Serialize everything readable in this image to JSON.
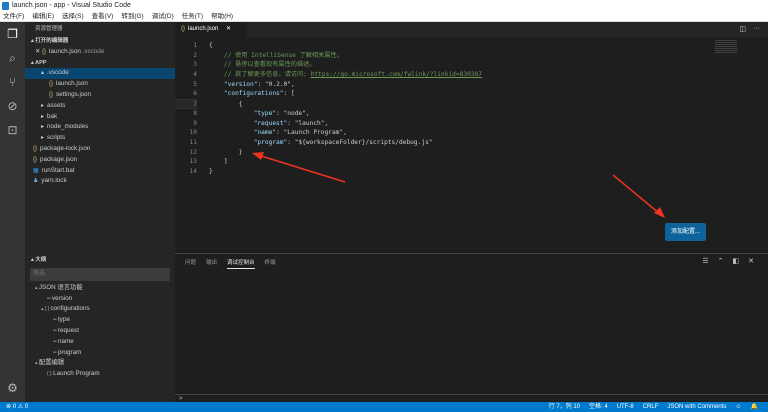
{
  "window": {
    "title": "launch.json - app - Visual Studio Code"
  },
  "menu": [
    "文件(F)",
    "编辑(E)",
    "选择(S)",
    "查看(V)",
    "转到(G)",
    "调试(D)",
    "任务(T)",
    "帮助(H)"
  ],
  "sidebar": {
    "title": "资源管理器",
    "open_editors_label": "打开的编辑器",
    "open_file": "launch.json",
    "open_file_dir": ".vscode",
    "project_label": "APP",
    "tree": [
      {
        "label": ".vscode",
        "kind": "folder-open",
        "depth": 1,
        "selected": true
      },
      {
        "label": "launch.json",
        "kind": "json",
        "depth": 2
      },
      {
        "label": "settings.json",
        "kind": "json",
        "depth": 2
      },
      {
        "label": "assets",
        "kind": "folder",
        "depth": 1
      },
      {
        "label": "bak",
        "kind": "folder",
        "depth": 1
      },
      {
        "label": "node_modules",
        "kind": "folder",
        "depth": 1
      },
      {
        "label": "scripts",
        "kind": "folder",
        "depth": 1
      },
      {
        "label": "package-lock.json",
        "kind": "json",
        "depth": 0
      },
      {
        "label": "package.json",
        "kind": "json",
        "depth": 0
      },
      {
        "label": "runStart.bat",
        "kind": "bat",
        "depth": 0
      },
      {
        "label": "yarn.lock",
        "kind": "lock",
        "depth": 0
      }
    ],
    "outline_label": "大纲",
    "filter_placeholder": "筛选",
    "outline": [
      {
        "label": "JSON 语言功能",
        "depth": 0,
        "icon": "▴"
      },
      {
        "label": "version",
        "depth": 2,
        "icon": "═"
      },
      {
        "label": "configurations",
        "depth": 1,
        "icon": "▴ [ ]"
      },
      {
        "label": "type",
        "depth": 3,
        "icon": "═"
      },
      {
        "label": "request",
        "depth": 3,
        "icon": "═"
      },
      {
        "label": "name",
        "depth": 3,
        "icon": "═"
      },
      {
        "label": "program",
        "depth": 3,
        "icon": "═"
      },
      {
        "label": "配置编辑",
        "depth": 0,
        "icon": "▴"
      },
      {
        "label": "Launch Program",
        "depth": 2,
        "icon": "{ }"
      }
    ]
  },
  "editor": {
    "tab": "launch.json",
    "lines": [
      "{",
      "    // 使用 IntelliSense 了解相关属性。",
      "    // 悬停以查看现有属性的描述。",
      "    // 欲了解更多信息，请访问: ",
      "    \"version\": \"0.2.0\",",
      "    \"configurations\": [",
      "        {",
      "            \"type\": \"node\",",
      "            \"request\": \"launch\",",
      "            \"name\": \"Launch Program\",",
      "            \"program\": \"${workspaceFolder}/scripts/debug.js\"",
      "        }",
      "    ]",
      "}"
    ],
    "link": "https://go.microsoft.com/fwlink/?linkid=830387",
    "add_config_button": "添加配置..."
  },
  "panel": {
    "tabs": [
      "问题",
      "输出",
      "调试控制台",
      "终端"
    ],
    "active_tab": "调试控制台",
    "prompt": ">"
  },
  "status": {
    "errors": "0",
    "warnings": "0",
    "position": "行 7，列 10",
    "spaces": "空格: 4",
    "encoding": "UTF-8",
    "eol": "CRLF",
    "language": "JSON with Comments"
  }
}
